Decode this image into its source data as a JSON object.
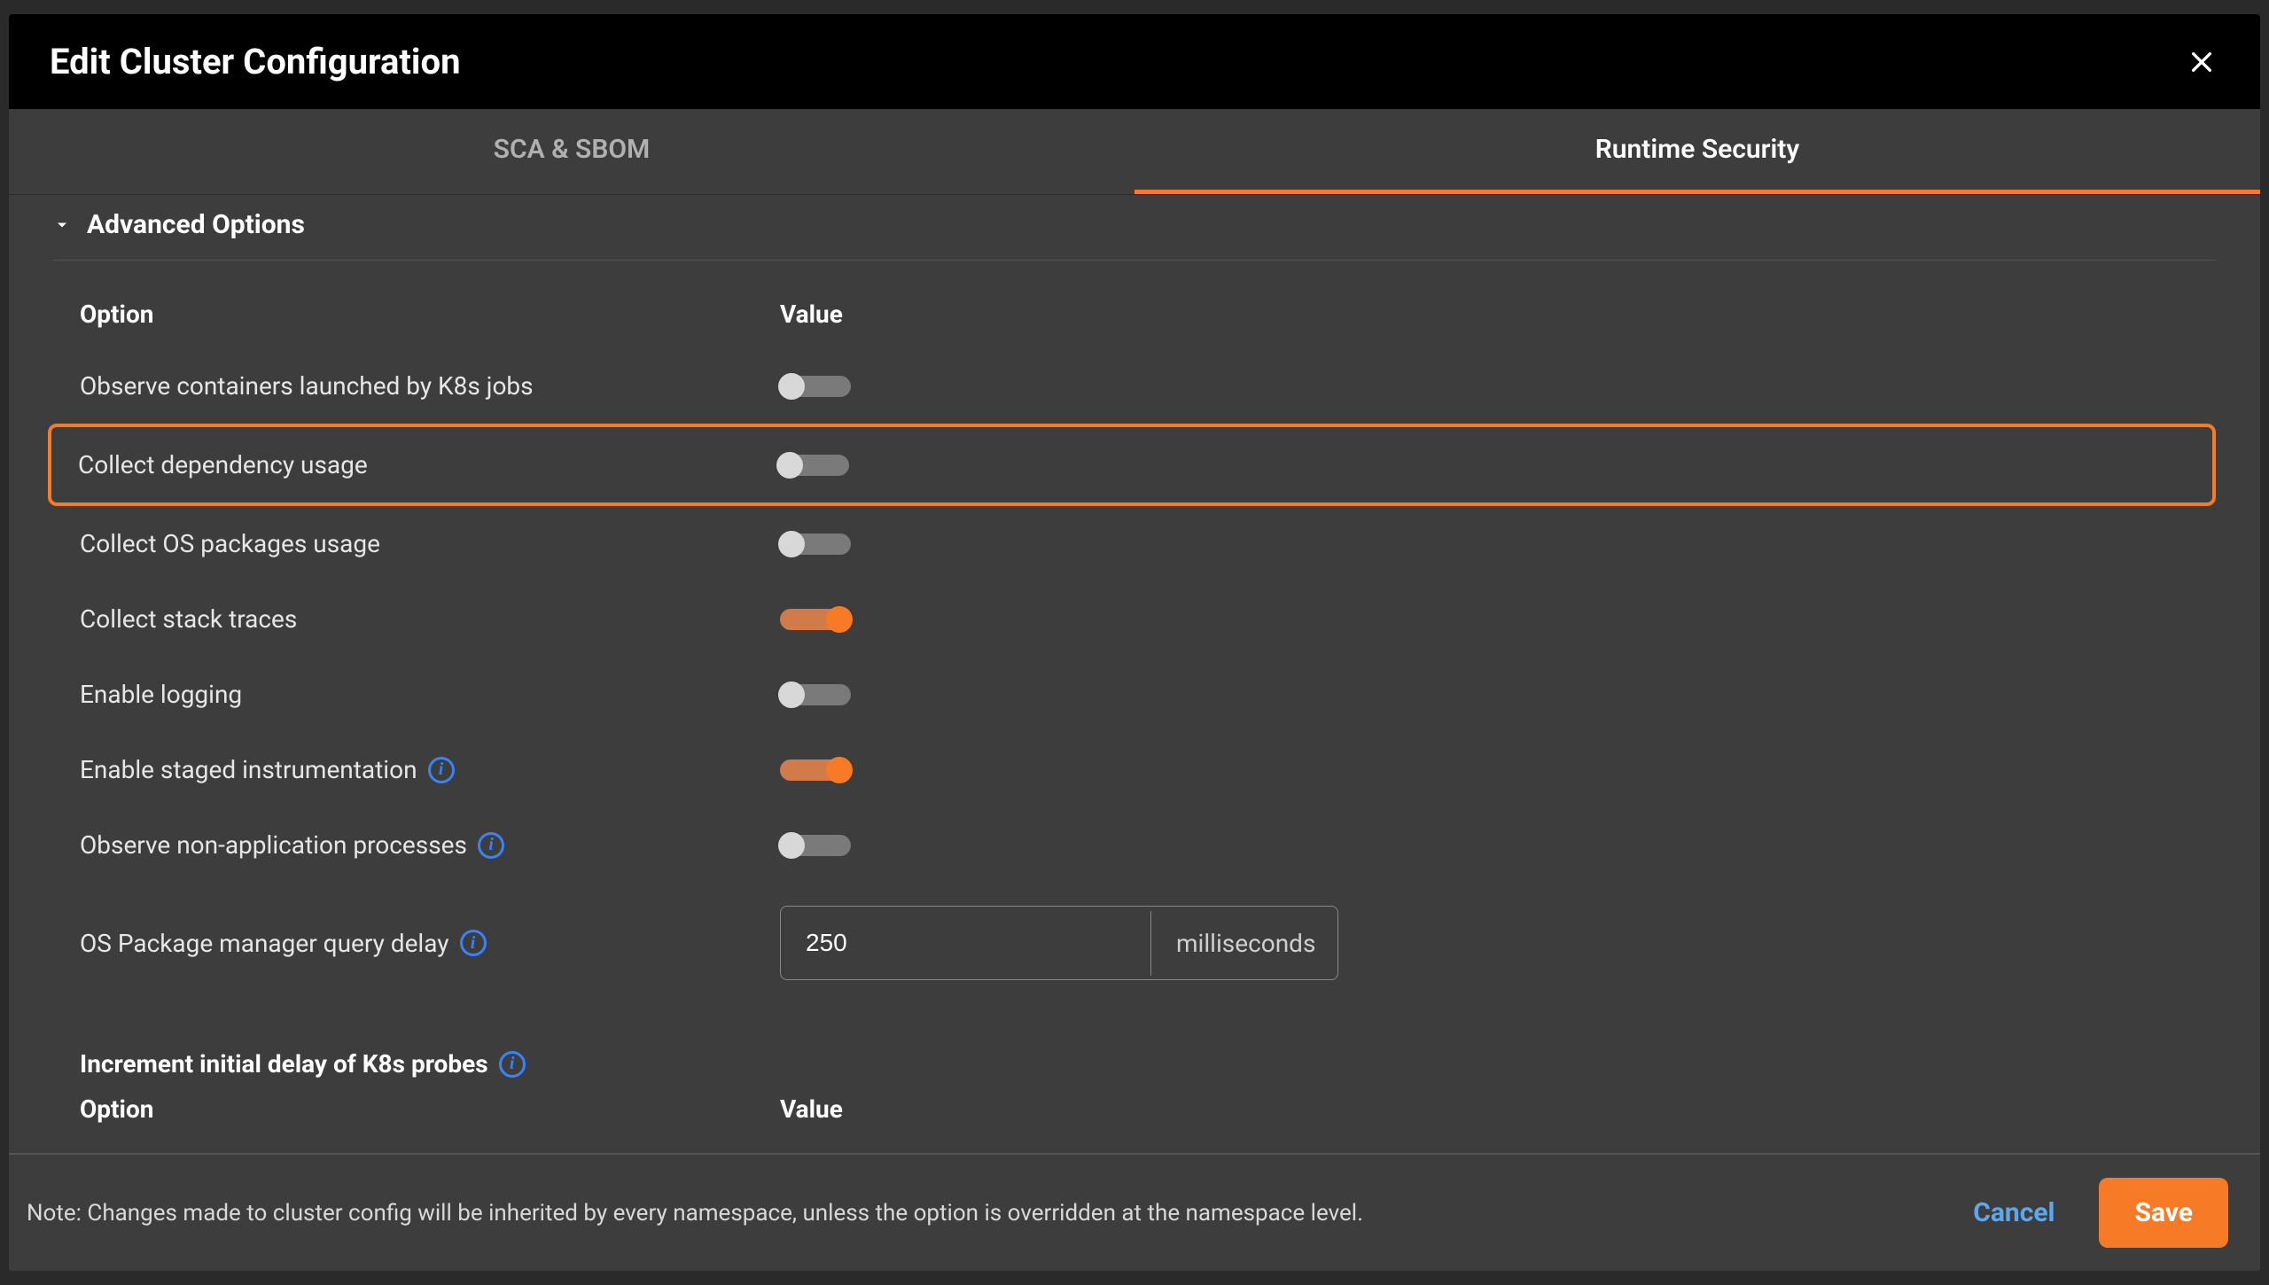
{
  "modal": {
    "title": "Edit Cluster Configuration"
  },
  "tabs": {
    "sca": "SCA & SBOM",
    "runtime": "Runtime Security"
  },
  "section": {
    "title": "Advanced Options"
  },
  "headers": {
    "option": "Option",
    "value": "Value"
  },
  "options": {
    "observe_k8s_jobs": {
      "label": "Observe containers launched by K8s jobs",
      "on": false
    },
    "collect_dependency": {
      "label": "Collect dependency usage",
      "on": false
    },
    "collect_os_packages": {
      "label": "Collect OS packages usage",
      "on": false
    },
    "collect_stack_traces": {
      "label": "Collect stack traces",
      "on": true
    },
    "enable_logging": {
      "label": "Enable logging",
      "on": false
    },
    "enable_staged_instrumentation": {
      "label": "Enable staged instrumentation",
      "on": true
    },
    "observe_non_app": {
      "label": "Observe non-application processes",
      "on": false
    },
    "os_pkg_delay": {
      "label": "OS Package manager query delay",
      "value": "250",
      "unit": "milliseconds"
    }
  },
  "subsection": {
    "title": "Increment initial delay of K8s probes"
  },
  "footer": {
    "note": "Note: Changes made to cluster config will be inherited by every namespace, unless the option is overridden at the namespace level.",
    "cancel": "Cancel",
    "save": "Save"
  }
}
